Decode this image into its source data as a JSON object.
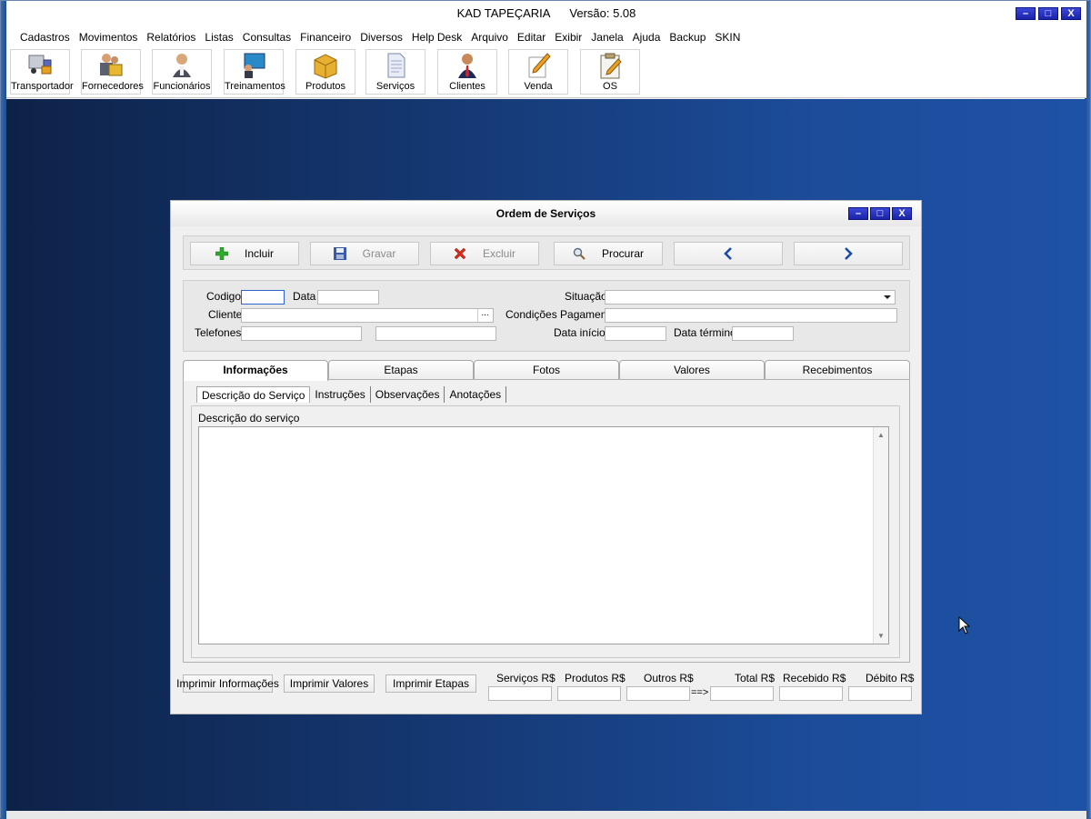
{
  "app": {
    "title": "KAD TAPEÇARIA      Versão: 5.08",
    "controls": [
      "–",
      "□",
      "X"
    ]
  },
  "menu": [
    "Cadastros",
    "Movimentos",
    "Relatórios",
    "Listas",
    "Consultas",
    "Financeiro",
    "Diversos",
    "Help Desk",
    "Arquivo",
    "Editar",
    "Exibir",
    "Janela",
    "Ajuda",
    "Backup",
    "SKIN"
  ],
  "toolbar": [
    {
      "label": "Transportador",
      "icon": "truck-icon"
    },
    {
      "label": "Fornecedores",
      "icon": "suppliers-icon"
    },
    {
      "label": "Funcionários",
      "icon": "employee-icon"
    },
    {
      "label": "Treinamentos",
      "icon": "training-icon"
    },
    {
      "label": "Produtos",
      "icon": "box-icon"
    },
    {
      "label": "Serviços",
      "icon": "document-icon"
    },
    {
      "label": "Clientes",
      "icon": "client-icon"
    },
    {
      "label": "Venda",
      "icon": "pencil-icon"
    },
    {
      "label": "OS",
      "icon": "clipboard-icon"
    }
  ],
  "window": {
    "title": "Ordem de Serviços",
    "controls": [
      "–",
      "□",
      "X"
    ],
    "actions": {
      "incluir": "Incluir",
      "gravar": "Gravar",
      "excluir": "Excluir",
      "procurar": "Procurar",
      "prev": "‹",
      "next": "›"
    },
    "form": {
      "codigo_label": "Codigo",
      "codigo_value": "",
      "data_label": "Data",
      "data_value": "",
      "situacao_label": "Situação",
      "situacao_value": "",
      "cliente_label": "Cliente",
      "cliente_value": "",
      "cliente_browse": "...",
      "condicoes_label": "Condições Pagamento",
      "condicoes_value": "",
      "telefones_label": "Telefones",
      "telefone1_value": "",
      "telefone2_value": "",
      "data_inicio_label": "Data início",
      "data_inicio_value": "",
      "data_termino_label": "Data término",
      "data_termino_value": ""
    },
    "tabs": [
      "Informações",
      "Etapas",
      "Fotos",
      "Valores",
      "Recebimentos"
    ],
    "active_tab": "Informações",
    "subtabs": [
      "Descrição do Serviço",
      "Instruções",
      "Observações",
      "Anotações"
    ],
    "active_subtab": "Descrição do Serviço",
    "description_label": "Descrição do serviço",
    "description_value": "",
    "print_buttons": [
      "Imprimir Informações",
      "Imprimir Valores",
      "Imprimir Etapas"
    ],
    "totals": {
      "servicos_label": "Serviços R$",
      "produtos_label": "Produtos R$",
      "outros_label": "Outros R$",
      "arrow": "==>",
      "total_label": "Total R$",
      "recebido_label": "Recebido R$",
      "debito_label": "Débito R$"
    }
  },
  "colors": {
    "desktop_gradient_start": "#0e2248",
    "desktop_gradient_end": "#1e52a6",
    "window_button": "#1a22a8",
    "focus_border": "#2e63c8"
  }
}
